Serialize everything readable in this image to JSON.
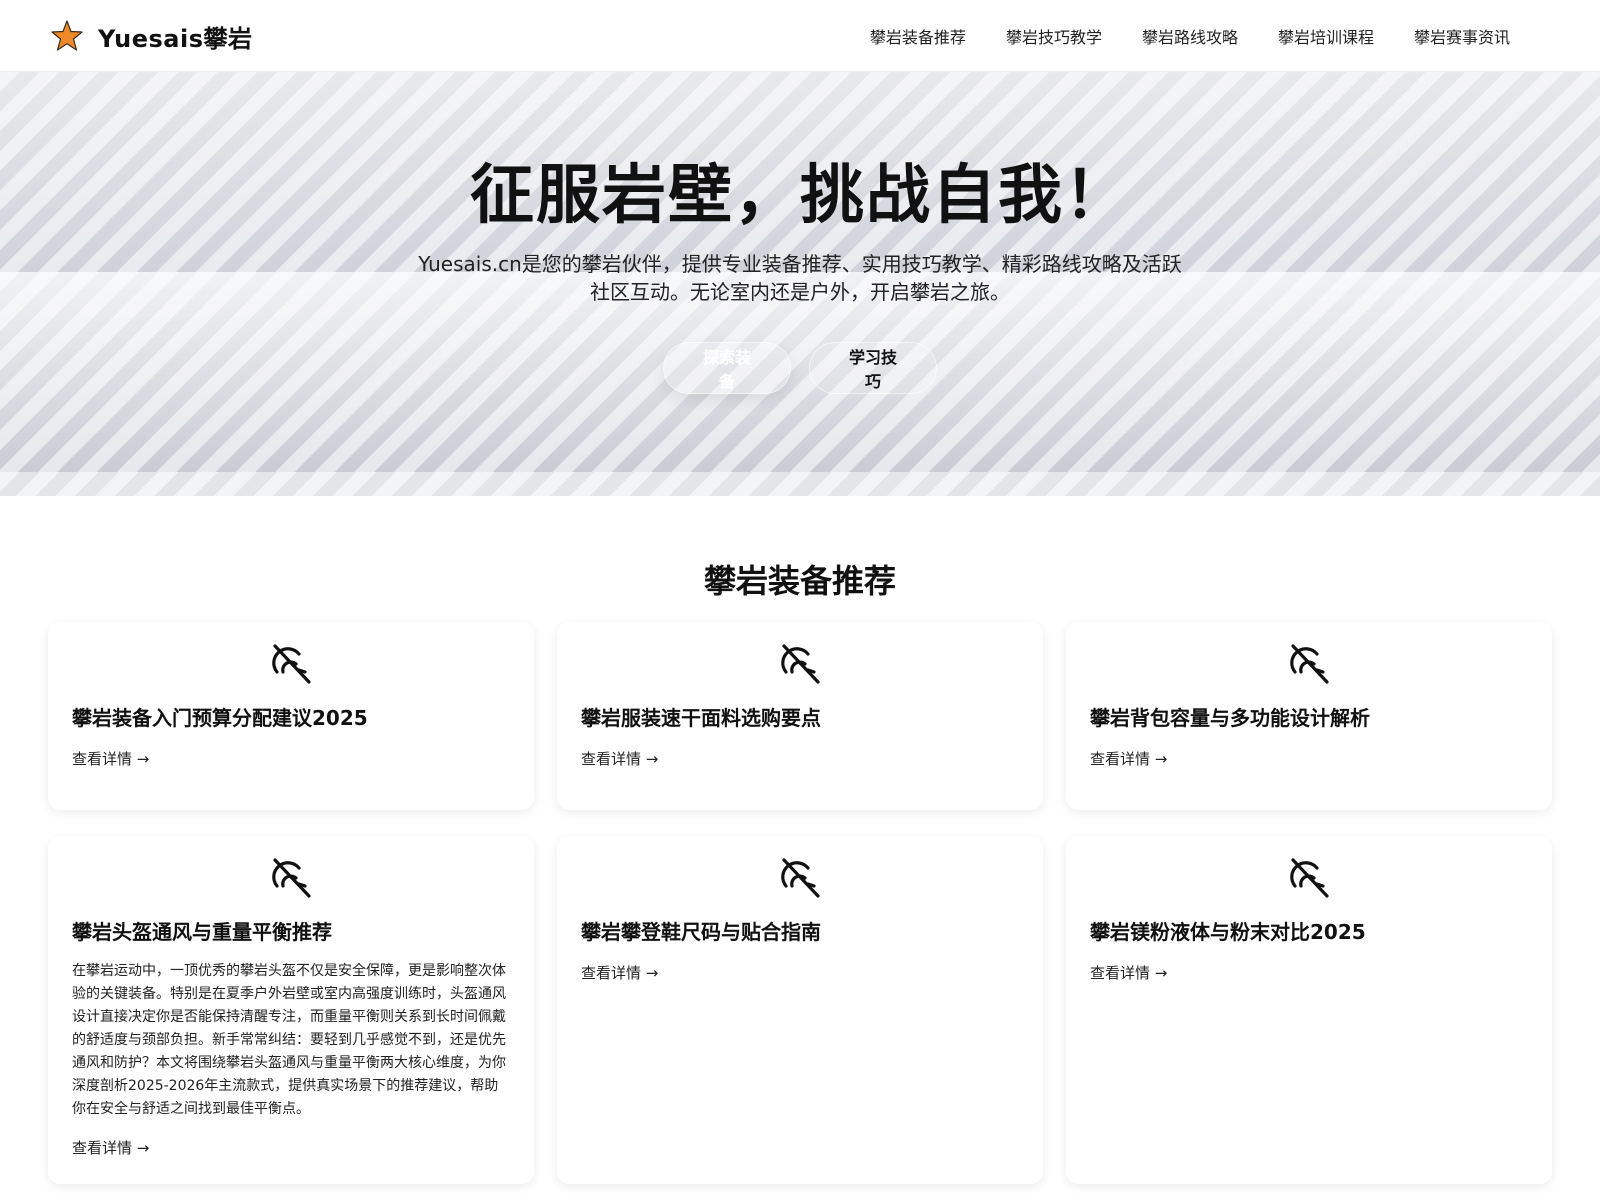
{
  "header": {
    "brand_name": "Yuesais攀岩",
    "brand_icon": "star-icon",
    "brand_color": "#f0892a",
    "nav": [
      {
        "label": "攀岩装备推荐"
      },
      {
        "label": "攀岩技巧教学"
      },
      {
        "label": "攀岩路线攻略"
      },
      {
        "label": "攀岩培训课程"
      },
      {
        "label": "攀岩赛事资讯"
      }
    ]
  },
  "hero": {
    "title": "征服岩壁，挑战自我！",
    "subtitle": "Yuesais.cn是您的攀岩伙伴，提供专业装备推荐、实用技巧教学、精彩路线攻略及活跃社区互动。无论室内还是户外，开启攀岩之旅。",
    "primary_button": "探索装备",
    "secondary_button": "学习技巧"
  },
  "section": {
    "title": "攀岩装备推荐"
  },
  "cards": [
    {
      "icon": "image-unavailable-icon",
      "title": "攀岩装备入门预算分配建议2025",
      "description": "",
      "link": "查看详情 →"
    },
    {
      "icon": "image-unavailable-icon",
      "title": "攀岩服装速干面料选购要点",
      "description": "",
      "link": "查看详情 →"
    },
    {
      "icon": "image-unavailable-icon",
      "title": "攀岩背包容量与多功能设计解析",
      "description": "",
      "link": "查看详情 →"
    },
    {
      "icon": "image-unavailable-icon",
      "title": "攀岩头盔通风与重量平衡推荐",
      "description": "在攀岩运动中，一顶优秀的攀岩头盔不仅是安全保障，更是影响整次体验的关键装备。特别是在夏季户外岩壁或室内高强度训练时，头盔通风设计直接决定你是否能保持清醒专注，而重量平衡则关系到长时间佩戴的舒适度与颈部负担。新手常常纠结：要轻到几乎感觉不到，还是优先通风和防护？本文将围绕攀岩头盔通风与重量平衡两大核心维度，为你深度剖析2025-2026年主流款式，提供真实场景下的推荐建议，帮助你在安全与舒适之间找到最佳平衡点。",
      "link": "查看详情 →"
    },
    {
      "icon": "image-unavailable-icon",
      "title": "攀岩攀登鞋尺码与贴合指南",
      "description": "",
      "link": "查看详情 →"
    },
    {
      "icon": "image-unavailable-icon",
      "title": "攀岩镁粉液体与粉末对比2025",
      "description": "",
      "link": "查看详情 →"
    }
  ]
}
